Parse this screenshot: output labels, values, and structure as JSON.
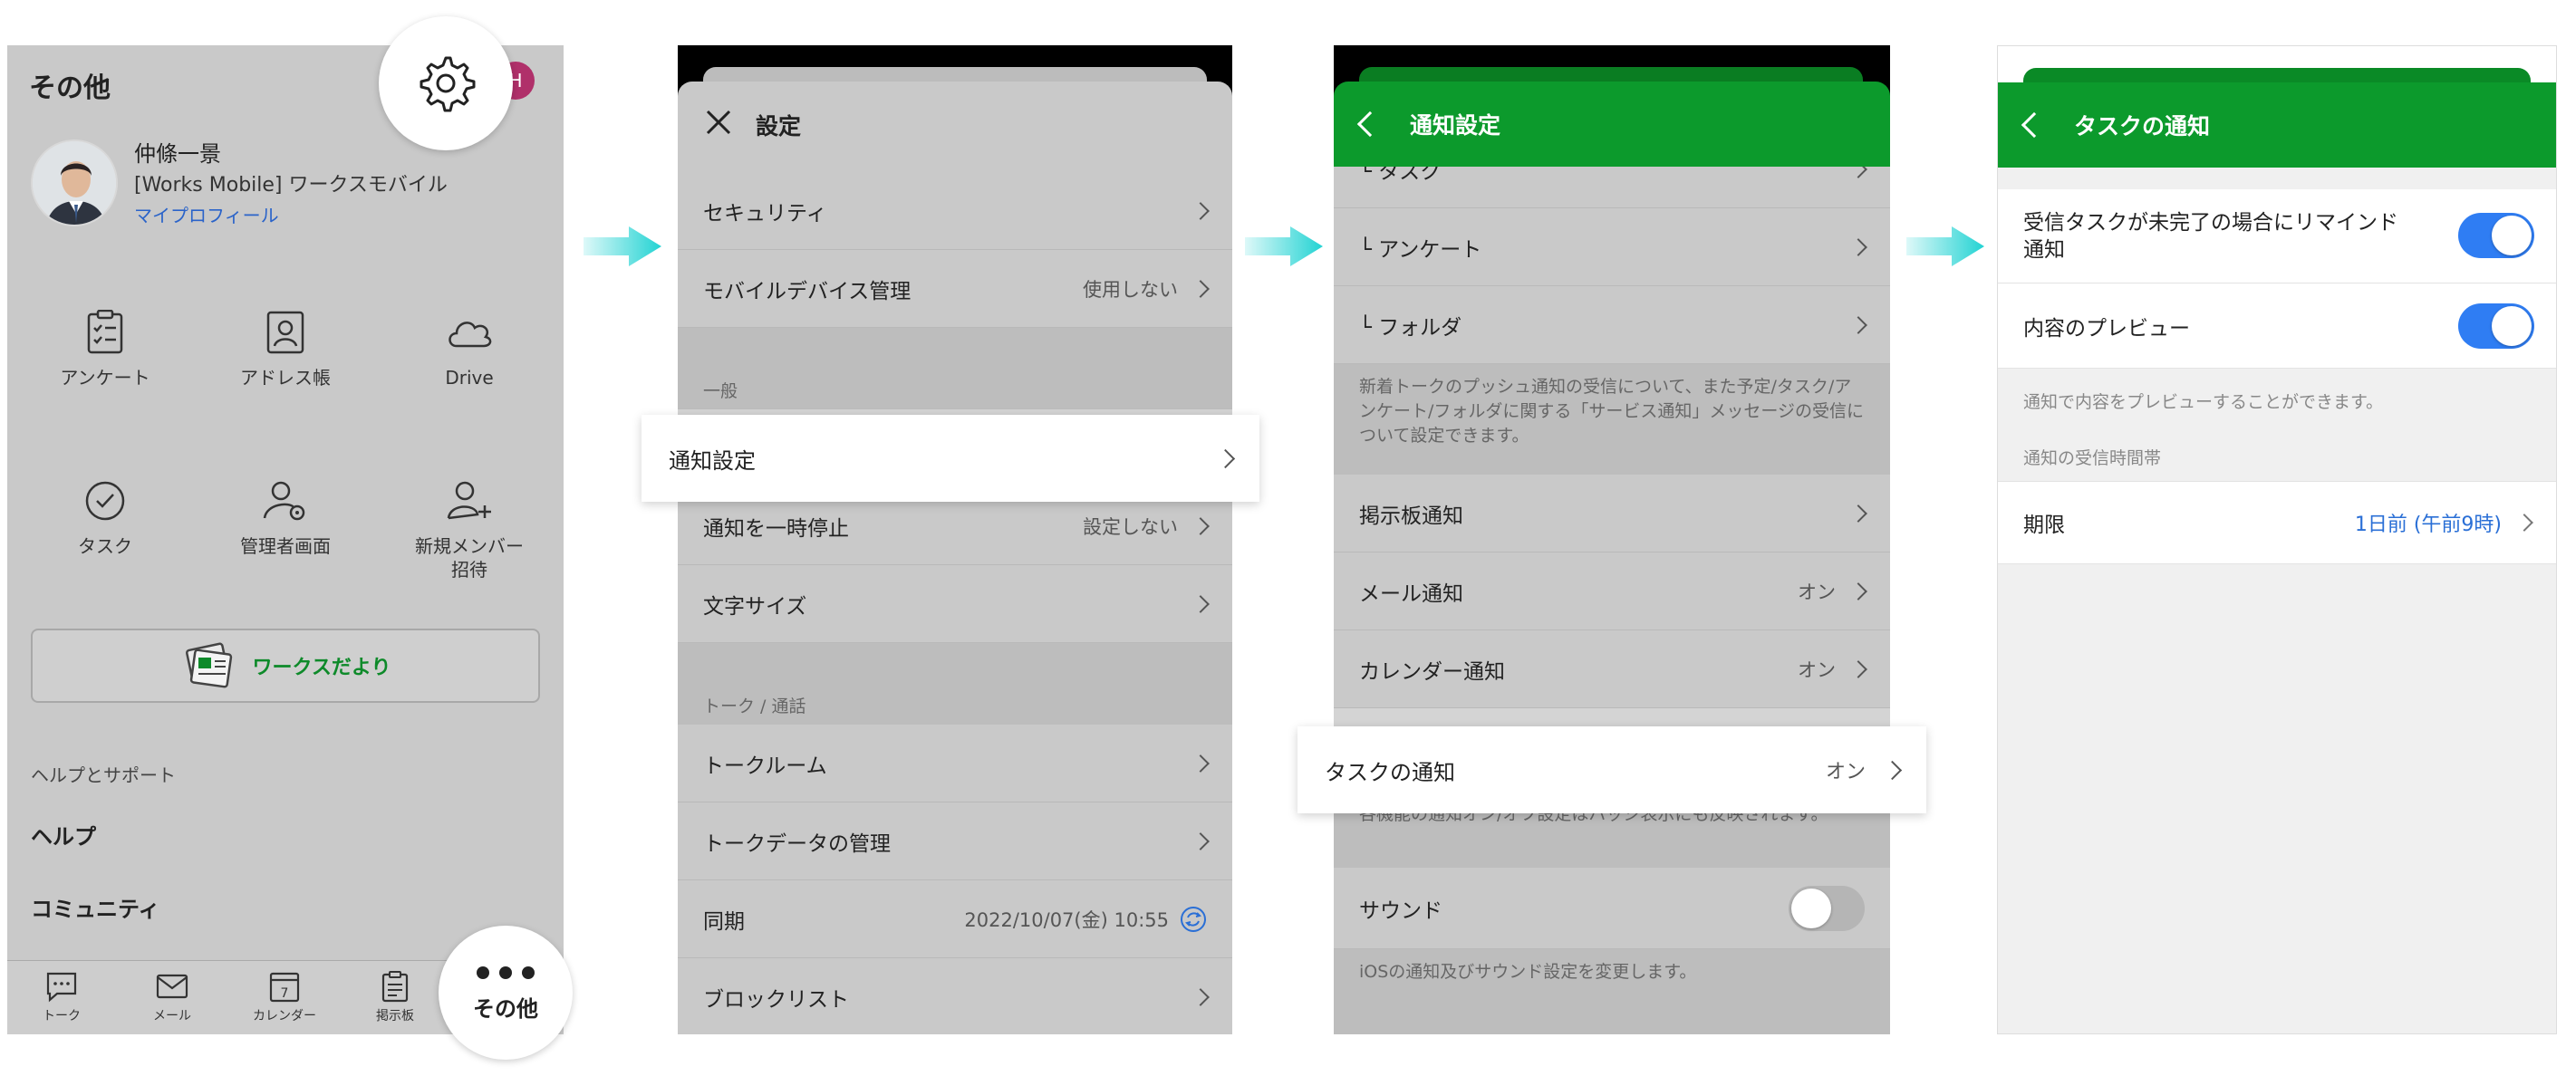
{
  "colors": {
    "accent_green": "#0c9a2c",
    "arrow_cyan": "#22d3d3",
    "toggle_on": "#2f7df3",
    "link_blue": "#2a6fd6"
  },
  "panel1": {
    "title": "その他",
    "avatar_letter": "H",
    "profile": {
      "name": "仲條一景",
      "org": "[Works Mobile] ワークスモバイル",
      "link": "マイプロフィール"
    },
    "grid": [
      {
        "label": "アンケート",
        "icon": "survey-icon"
      },
      {
        "label": "アドレス帳",
        "icon": "address-book-icon"
      },
      {
        "label": "Drive",
        "icon": "cloud-icon"
      },
      {
        "label": "タスク",
        "icon": "task-check-icon"
      },
      {
        "label": "管理者画面",
        "icon": "admin-icon"
      },
      {
        "label": "新規メンバー",
        "label2": "招待",
        "icon": "add-member-icon"
      }
    ],
    "news_button": "ワークスだより",
    "help_section": "ヘルプとサポート",
    "help_items": [
      "ヘルプ",
      "コミュニティ"
    ],
    "tabs": [
      "トーク",
      "メール",
      "カレンダー",
      "掲示板",
      "その他"
    ],
    "calendar_day": "7"
  },
  "panel2": {
    "title": "設定",
    "rows_top": [
      {
        "label": "セキュリティ",
        "value": ""
      },
      {
        "label": "モバイルデバイス管理",
        "value": "使用しない"
      }
    ],
    "section_general": "一般",
    "highlight": "通知設定",
    "rows_general": [
      {
        "label": "通知を一時停止",
        "value": "設定しない"
      },
      {
        "label": "文字サイズ",
        "value": ""
      }
    ],
    "section_talk": "トーク / 通話",
    "rows_talk": [
      {
        "label": "トークルーム",
        "value": ""
      },
      {
        "label": "トークデータの管理",
        "value": ""
      },
      {
        "label": "同期",
        "value": "2022/10/07(金) 10:55"
      },
      {
        "label": "ブロックリスト",
        "value": ""
      }
    ]
  },
  "panel3": {
    "title": "通知設定",
    "sub_rows": [
      "タスク",
      "アンケート",
      "フォルダ"
    ],
    "description": "新着トークのプッシュ通知の受信について、また予定/タスク/アンケート/フォルダに関する「サービス通知」メッセージの受信について設定できます。",
    "rows": [
      {
        "label": "掲示板通知",
        "value": ""
      },
      {
        "label": "メール通知",
        "value": "オン"
      },
      {
        "label": "カレンダー通知",
        "value": "オン"
      }
    ],
    "highlight": {
      "label": "タスクの通知",
      "value": "オン"
    },
    "badge_note": "各機能の通知オン/オフ設定はバッジ表示にも反映されます。",
    "sound_label": "サウンド",
    "sound_on": false,
    "ios_note": "iOSの通知及びサウンド設定を変更します。"
  },
  "panel4": {
    "title": "タスクの通知",
    "reminder_label": "受信タスクが未完了の場合にリマインド",
    "reminder_label2": "通知",
    "reminder_on": true,
    "preview_label": "内容のプレビュー",
    "preview_on": true,
    "preview_note": "通知で内容をプレビューすることができます。",
    "time_section": "通知の受信時間帯",
    "deadline_label": "期限",
    "deadline_value": "1日前 (午前9時)"
  }
}
